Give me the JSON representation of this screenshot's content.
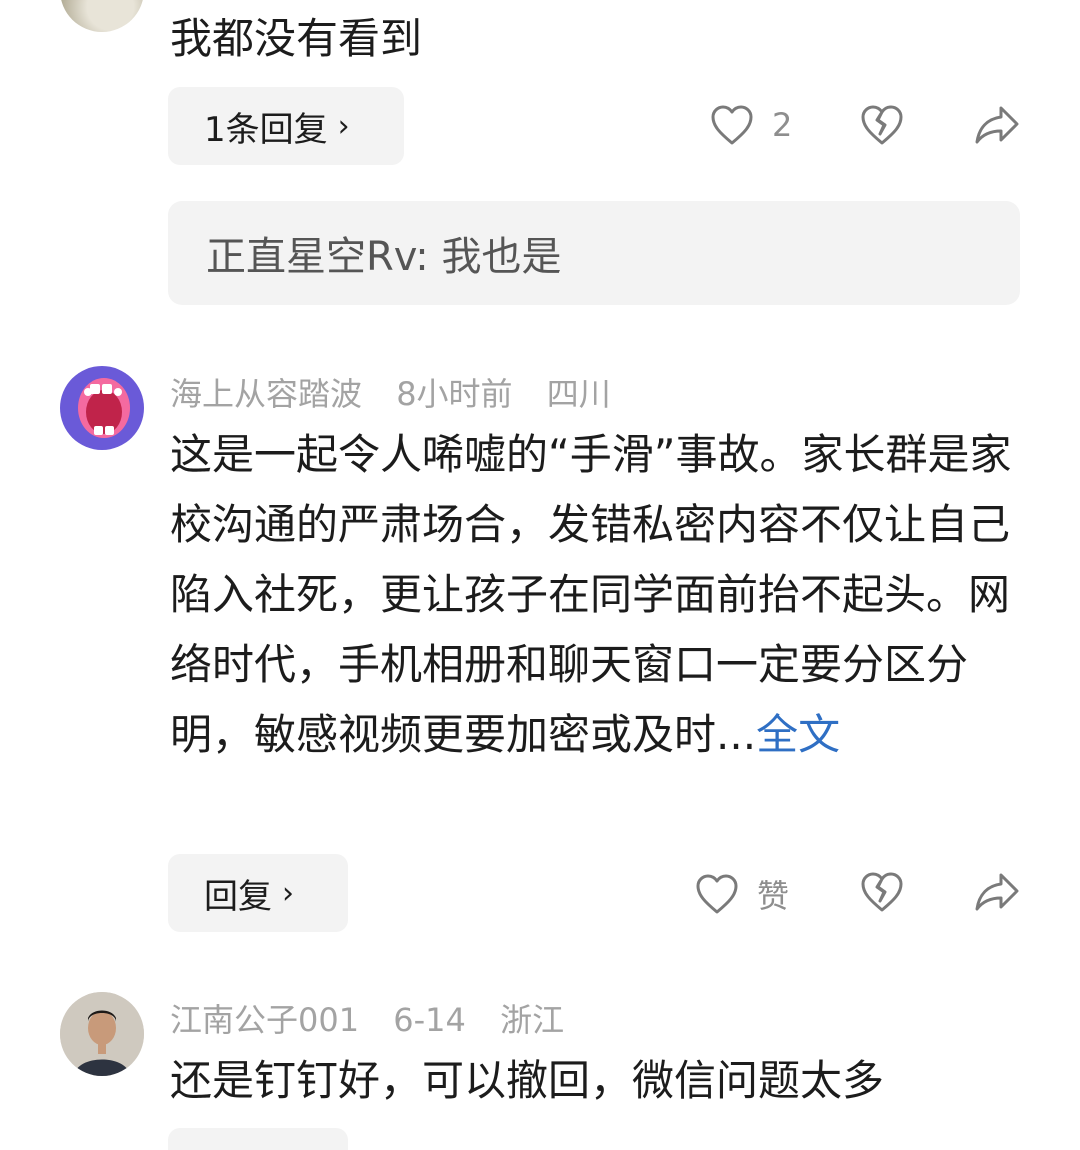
{
  "comments": [
    {
      "text": "我都没有看到",
      "reply_label": "1条回复",
      "like_count": "2",
      "quoted_reply": "正直星空Rv: 我也是"
    },
    {
      "username": "海上从容踏波",
      "time": "8小时前",
      "location": "四川",
      "text": "这是一起令人唏嘘的“手滑”事故。家长群是家校沟通的严肃场合，发错私密内容不仅让自己陷入社死，更让孩子在同学面前抬不起头。网络时代，手机相册和聊天窗口一定要分区分明，敏感视频更要加密或及时...",
      "expand_label": "全文",
      "reply_label": "回复",
      "like_label": "赞"
    },
    {
      "username": "江南公子001",
      "time": "6-14",
      "location": "浙江",
      "text": "还是钉钉好，可以撤回，微信问题太多"
    }
  ],
  "icons": {
    "like": "heart-outline-icon",
    "dislike": "broken-heart-icon",
    "share": "share-arrow-icon",
    "chevron": "chevron-right-icon"
  },
  "colors": {
    "link": "#2f6fc4",
    "meta": "#a3a3a3",
    "button_bg": "#f3f3f3"
  }
}
